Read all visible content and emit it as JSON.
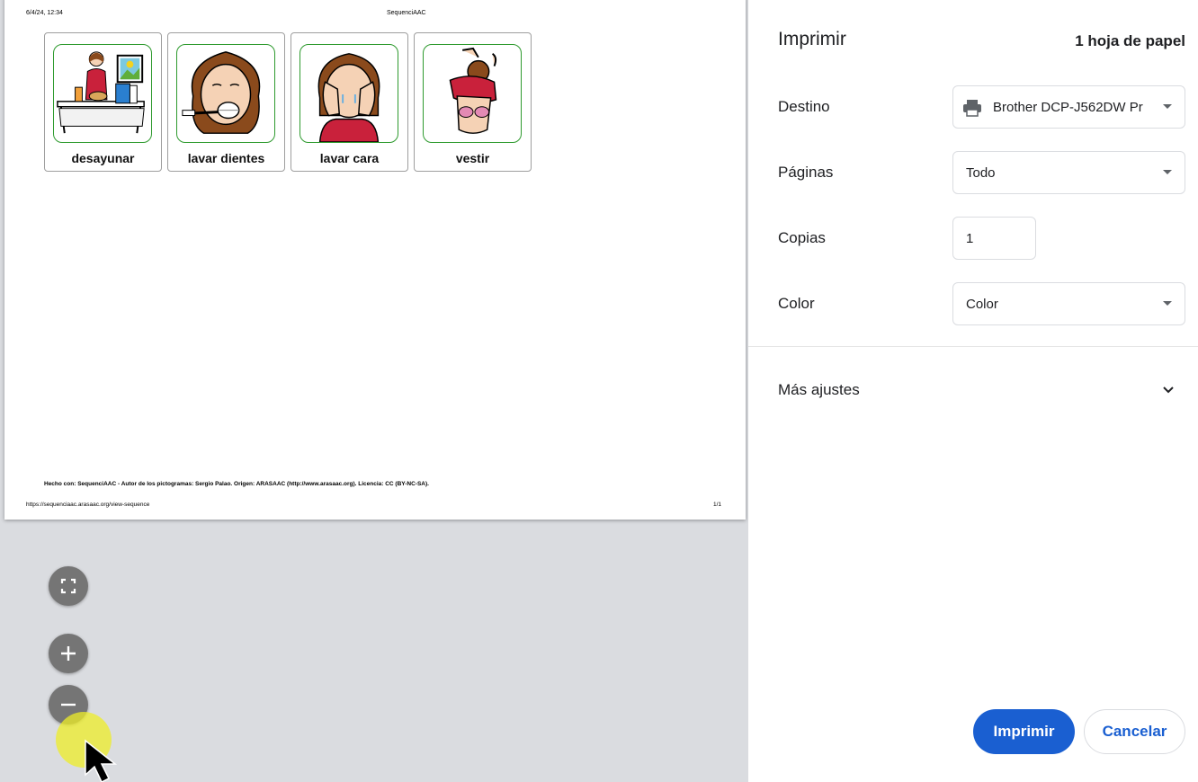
{
  "preview": {
    "header_date": "6/4/24, 12:34",
    "header_title": "SequenciAAC",
    "cards": [
      {
        "label": "desayunar",
        "icon": "breakfast-pictogram"
      },
      {
        "label": "lavar dientes",
        "icon": "brush-teeth-pictogram"
      },
      {
        "label": "lavar cara",
        "icon": "wash-face-pictogram"
      },
      {
        "label": "vestir",
        "icon": "dress-pictogram"
      }
    ],
    "credits": "Hecho con: SequenciAAC - Autor de los pictogramas: Sergio Palao. Origen: ARASAAC (http://www.arasaac.org). Licencia: CC (BY-NC-SA).",
    "footer_url": "https://sequenciaac.arasaac.org/view-sequence",
    "page_number": "1/1"
  },
  "zoom_controls": {
    "fit_icon": "fullscreen-icon",
    "zoom_in_icon": "plus-icon",
    "zoom_out_icon": "minus-icon"
  },
  "panel": {
    "title": "Imprimir",
    "sheets": "1 hoja de papel",
    "destination": {
      "label": "Destino",
      "value": "Brother DCP-J562DW Pr",
      "icon": "printer-icon"
    },
    "pages": {
      "label": "Páginas",
      "value": "Todo"
    },
    "copies": {
      "label": "Copias",
      "value": "1"
    },
    "color": {
      "label": "Color",
      "value": "Color"
    },
    "more_settings": "Más ajustes",
    "print_button": "Imprimir",
    "cancel_button": "Cancelar"
  },
  "colors": {
    "accent": "#1a5fd1",
    "card_border": "#2e9a2e",
    "preview_bg": "#dadce0"
  }
}
